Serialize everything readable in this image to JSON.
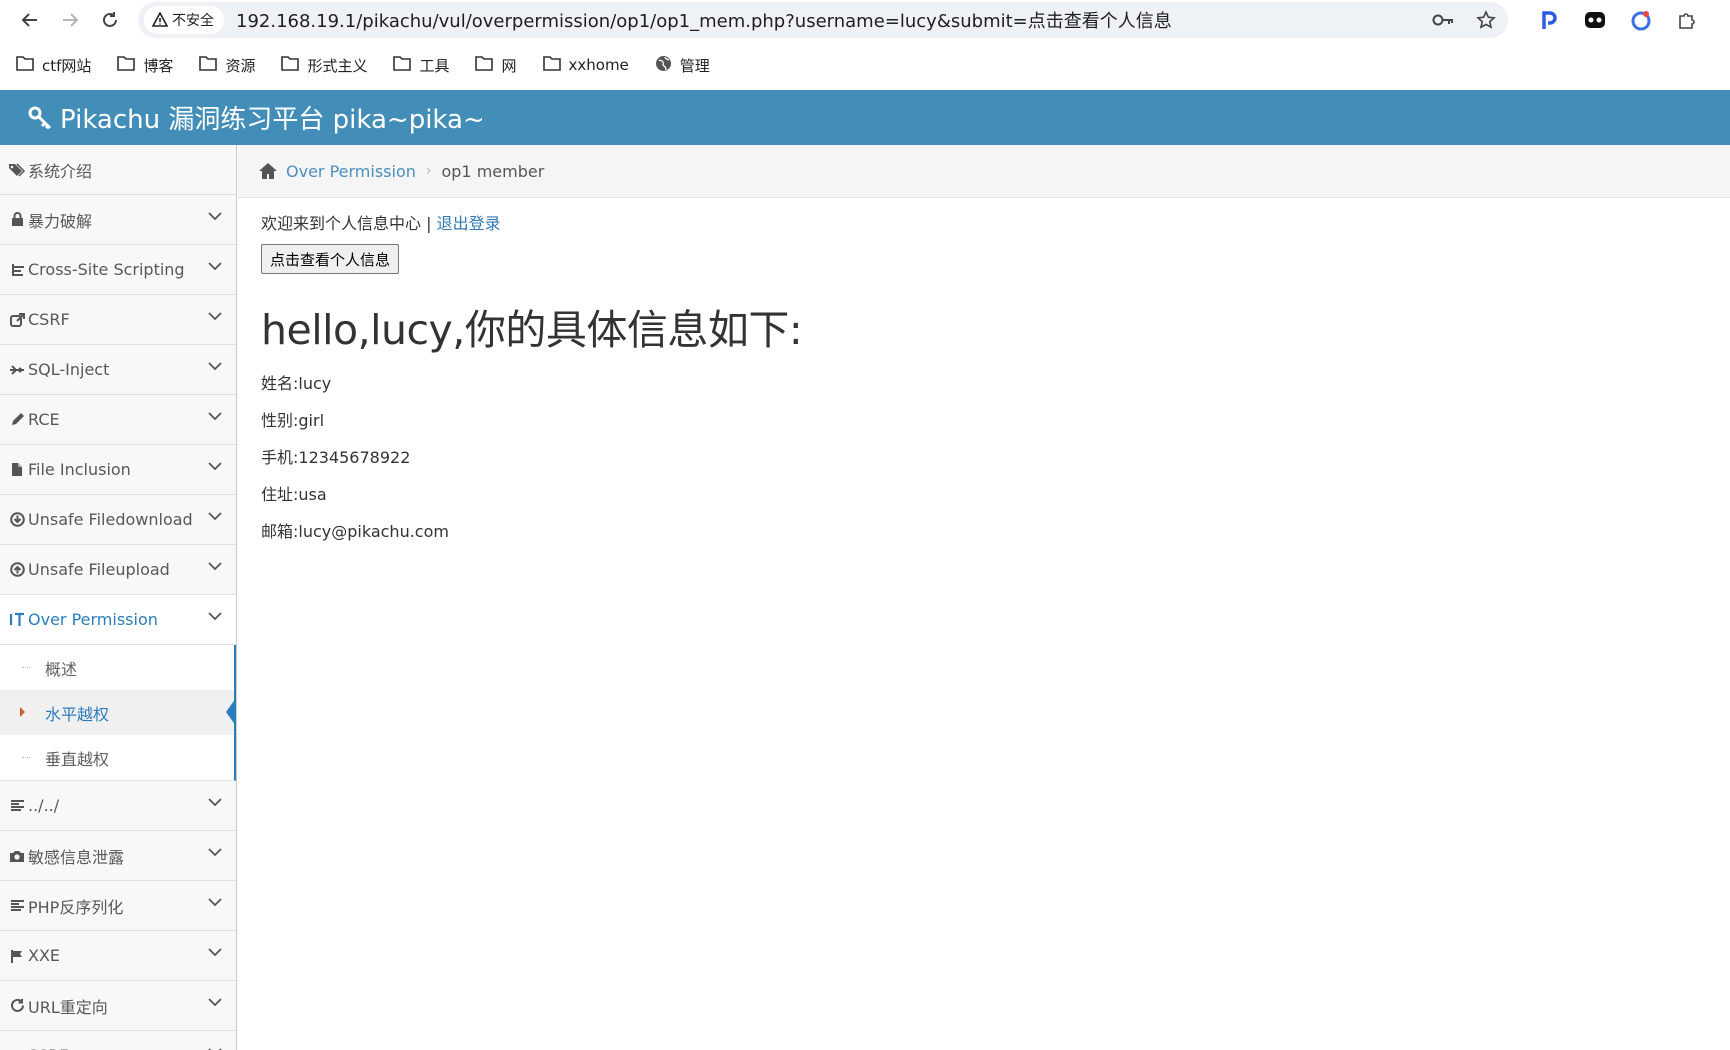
{
  "browser": {
    "security_label": "不安全",
    "url": "192.168.19.1/pikachu/vul/overpermission/op1/op1_mem.php?username=lucy&submit=点击查看个人信息"
  },
  "bookmarks": [
    {
      "label": "ctf网站",
      "icon": "folder-icon"
    },
    {
      "label": "博客",
      "icon": "folder-icon"
    },
    {
      "label": "资源",
      "icon": "folder-icon"
    },
    {
      "label": "形式主义",
      "icon": "folder-icon"
    },
    {
      "label": "工具",
      "icon": "folder-icon"
    },
    {
      "label": "网",
      "icon": "folder-icon"
    },
    {
      "label": "xxhome",
      "icon": "folder-icon"
    },
    {
      "label": "管理",
      "icon": "globe-icon"
    }
  ],
  "header": {
    "title": "Pikachu 漏洞练习平台 pika~pika~"
  },
  "sidebar": {
    "items": [
      {
        "label": "系统介绍",
        "icon": "tags-icon"
      },
      {
        "label": "暴力破解",
        "icon": "lock-icon"
      },
      {
        "label": "Cross-Site Scripting",
        "icon": "list-icon"
      },
      {
        "label": "CSRF",
        "icon": "share-icon"
      },
      {
        "label": "SQL-Inject",
        "icon": "fighter-jet-icon"
      },
      {
        "label": "RCE",
        "icon": "pencil-icon"
      },
      {
        "label": "File Inclusion",
        "icon": "file-icon"
      },
      {
        "label": "Unsafe Filedownload",
        "icon": "download-icon"
      },
      {
        "label": "Unsafe Fileupload",
        "icon": "upload-icon"
      },
      {
        "label": "Over Permission",
        "icon": "text-height-icon"
      },
      {
        "label": "../../",
        "icon": "align-left-icon"
      },
      {
        "label": "敏感信息泄露",
        "icon": "camera-icon"
      },
      {
        "label": "PHP反序列化",
        "icon": "align-left-icon"
      },
      {
        "label": "XXE",
        "icon": "flag-icon"
      },
      {
        "label": "URL重定向",
        "icon": "refresh-icon"
      },
      {
        "label": "SSRF",
        "icon": "align-left-icon"
      }
    ],
    "over_permission_sub": [
      {
        "label": "概述"
      },
      {
        "label": "水平越权"
      },
      {
        "label": "垂直越权"
      }
    ]
  },
  "breadcrumbs": {
    "parent": "Over Permission",
    "current": "op1 member"
  },
  "main": {
    "welcome": "欢迎来到个人信息中心 | ",
    "logout": "退出登录",
    "button": "点击查看个人信息",
    "hello": "hello,lucy,你的具体信息如下:",
    "info": [
      "姓名:lucy",
      "性别:girl",
      "手机:12345678922",
      "住址:usa",
      "邮箱:lucy@pikachu.com"
    ]
  },
  "colors": {
    "header_bg": "#438eb9",
    "active": "#2b7dbc",
    "link": "#337ab7"
  }
}
